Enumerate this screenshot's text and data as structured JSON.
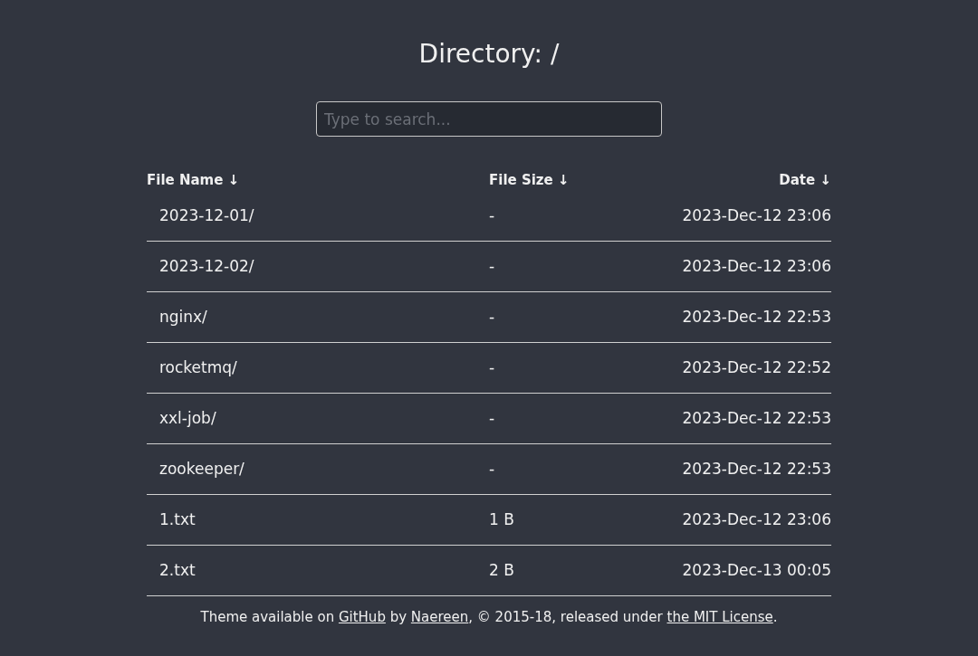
{
  "title": "Directory: /",
  "search": {
    "placeholder": "Type to search..."
  },
  "table": {
    "columns": [
      "File Name ↓",
      "File Size ↓",
      "Date ↓"
    ],
    "rows": [
      {
        "name": "2023-12-01/",
        "size": "-",
        "date": "2023-Dec-12 23:06"
      },
      {
        "name": "2023-12-02/",
        "size": "-",
        "date": "2023-Dec-12 23:06"
      },
      {
        "name": "nginx/",
        "size": "-",
        "date": "2023-Dec-12 22:53"
      },
      {
        "name": "rocketmq/",
        "size": "-",
        "date": "2023-Dec-12 22:52"
      },
      {
        "name": "xxl-job/",
        "size": "-",
        "date": "2023-Dec-12 22:53"
      },
      {
        "name": "zookeeper/",
        "size": "-",
        "date": "2023-Dec-12 22:53"
      },
      {
        "name": "1.txt",
        "size": "1 B",
        "date": "2023-Dec-12 23:06"
      },
      {
        "name": "2.txt",
        "size": "2 B",
        "date": "2023-Dec-13 00:05"
      }
    ]
  },
  "footer": [
    {
      "kind": "text",
      "text": "Theme available on "
    },
    {
      "kind": "link",
      "text": "GitHub"
    },
    {
      "kind": "text",
      "text": " by "
    },
    {
      "kind": "link",
      "text": "Naereen"
    },
    {
      "kind": "text",
      "text": ", © 2015-18, released under "
    },
    {
      "kind": "link",
      "text": "the MIT License"
    },
    {
      "kind": "text",
      "text": "."
    }
  ]
}
